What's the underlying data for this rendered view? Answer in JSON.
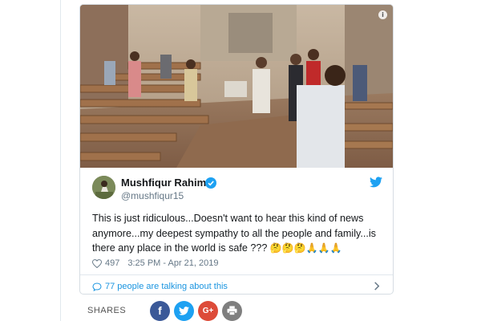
{
  "tweet": {
    "display_name": "Mushfiqur Rahim",
    "handle": "@mushfiqur15",
    "text": "This is just ridiculous...Doesn't want to hear this kind of news anymore...my deepest sympathy to all the people and family...is there any place in the world is safe ??? ",
    "emojis": "🤔🤔🤔🙏🙏🙏",
    "like_count": "497",
    "timestamp": "3:25 PM - Apr 21, 2019",
    "talking_text": "77 people are talking about this"
  },
  "icons": {
    "info": "info-icon",
    "verified": "verified-badge-icon",
    "twitter": "twitter-bird-icon",
    "like": "heart-icon",
    "comment": "comment-bubble-icon",
    "chevron": "chevron-right-icon"
  },
  "share": {
    "label": "SHARES",
    "buttons": [
      {
        "name": "facebook",
        "glyph": "f",
        "color": "#3b5998"
      },
      {
        "name": "twitter",
        "glyph": "twitter-bird-icon",
        "color": "#1da1f2"
      },
      {
        "name": "google-plus",
        "glyph": "G+",
        "color": "#dd4b39"
      },
      {
        "name": "print",
        "glyph": "printer-icon",
        "color": "#7f7f7f"
      }
    ]
  },
  "colors": {
    "twitter_blue": "#1da1f2",
    "link_blue": "#1b95e0",
    "muted_text": "#657786"
  }
}
